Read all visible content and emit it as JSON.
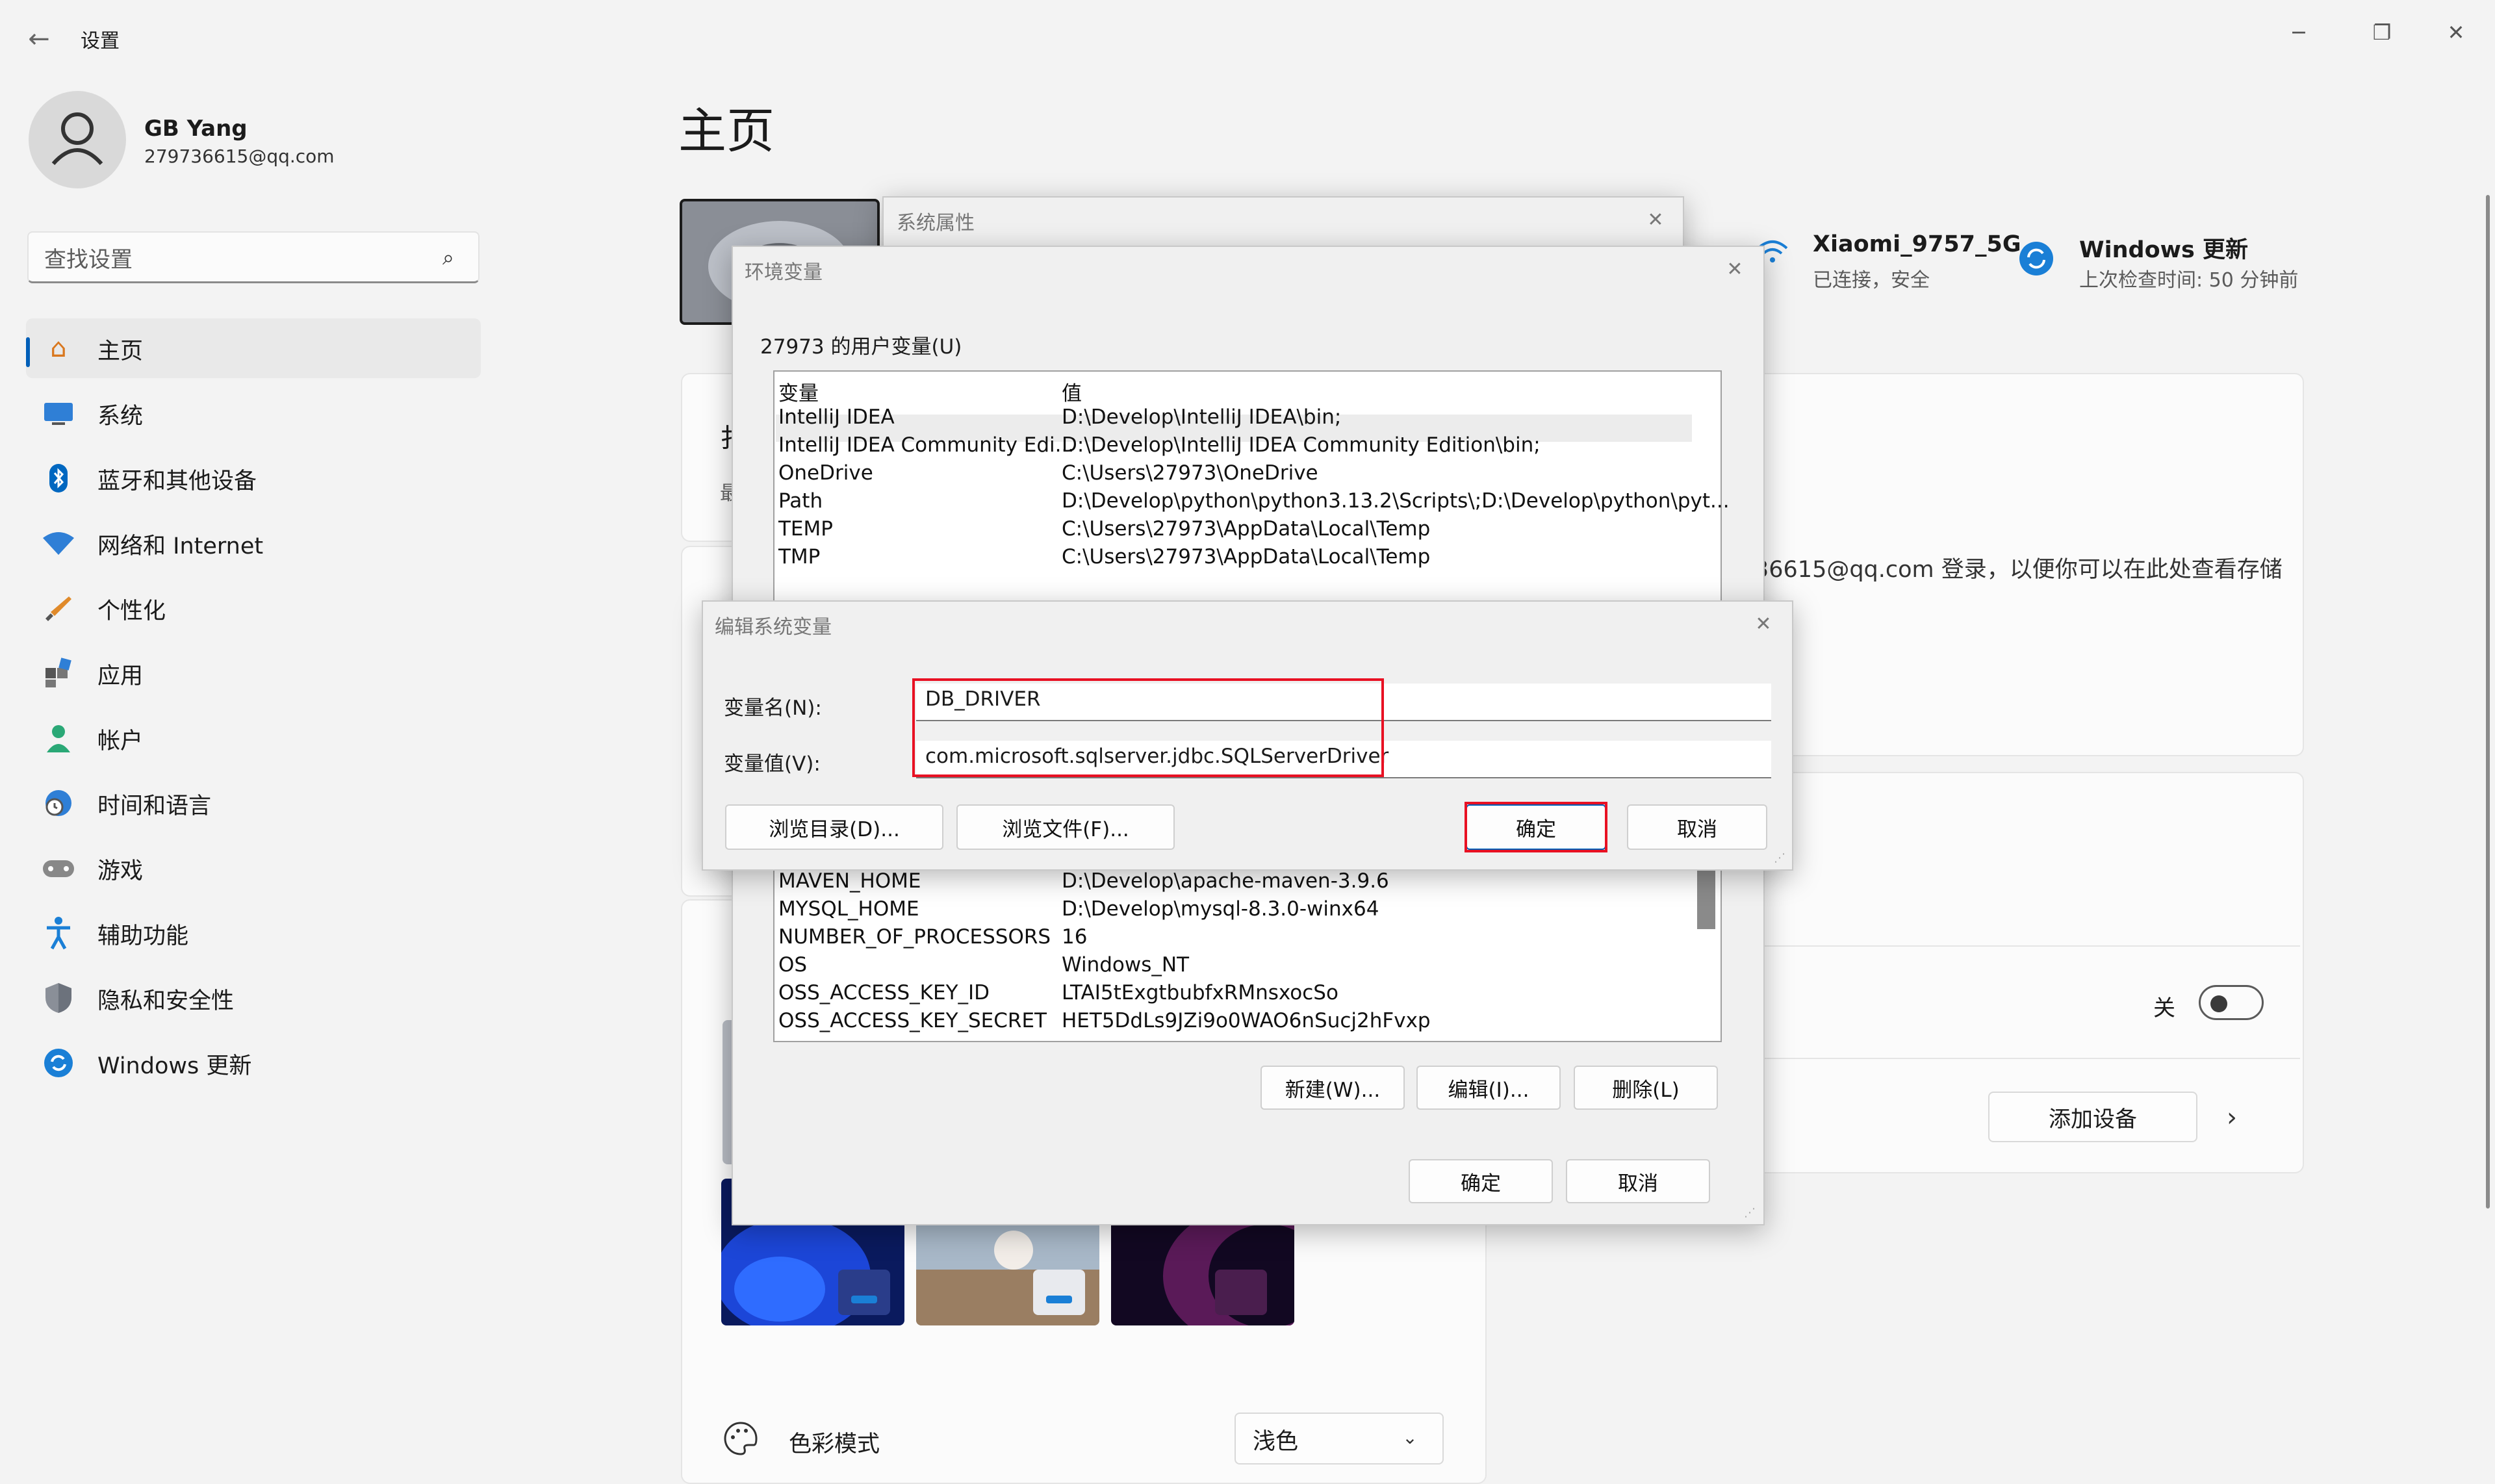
{
  "settings": {
    "title": "设置",
    "user": {
      "name": "GB Yang",
      "email": "279736615@qq.com"
    },
    "search_placeholder": "查找设置",
    "nav": [
      {
        "label": "主页",
        "icon": "home-icon"
      },
      {
        "label": "系统",
        "icon": "monitor-icon"
      },
      {
        "label": "蓝牙和其他设备",
        "icon": "bluetooth-icon"
      },
      {
        "label": "网络和 Internet",
        "icon": "wifi-icon"
      },
      {
        "label": "个性化",
        "icon": "brush-icon"
      },
      {
        "label": "应用",
        "icon": "apps-icon"
      },
      {
        "label": "帐户",
        "icon": "person-icon"
      },
      {
        "label": "时间和语言",
        "icon": "globe-clock-icon"
      },
      {
        "label": "游戏",
        "icon": "gamepad-icon"
      },
      {
        "label": "辅助功能",
        "icon": "accessibility-icon"
      },
      {
        "label": "隐私和安全性",
        "icon": "shield-icon"
      },
      {
        "label": "Windows 更新",
        "icon": "sync-icon"
      }
    ],
    "page_title": "主页",
    "wifi": {
      "name": "Xiaomi_9757_5G",
      "status": "已连接，安全"
    },
    "update": {
      "title": "Windows 更新",
      "status": "上次检查时间: 50 分钟前"
    },
    "onedrive_text": "36615@qq.com 登录，以便你可以在此处查看存储",
    "toggle_label": "关",
    "add_device": "添加设备",
    "color_mode": {
      "label": "色彩模式",
      "value": "浅色"
    },
    "partial_card_chars": [
      "扌",
      "最"
    ],
    "accent": "#005fb8"
  },
  "sys_props": {
    "title": "系统属性"
  },
  "env_vars": {
    "title": "环境变量",
    "user_section": "27973 的用户变量(U)",
    "headers": [
      "变量",
      "值"
    ],
    "user_vars": [
      {
        "name": "IntelliJ IDEA",
        "value": "D:\\Develop\\IntelliJ IDEA\\bin;"
      },
      {
        "name": "IntelliJ IDEA Community Edi...",
        "value": "D:\\Develop\\IntelliJ IDEA Community Edition\\bin;"
      },
      {
        "name": "OneDrive",
        "value": "C:\\Users\\27973\\OneDrive"
      },
      {
        "name": "Path",
        "value": "D:\\Develop\\python\\python3.13.2\\Scripts\\;D:\\Develop\\python\\pyt..."
      },
      {
        "name": "TEMP",
        "value": "C:\\Users\\27973\\AppData\\Local\\Temp"
      },
      {
        "name": "TMP",
        "value": "C:\\Users\\27973\\AppData\\Local\\Temp"
      }
    ],
    "system_vars": [
      {
        "name": "MAVEN_HOME",
        "value": "D:\\Develop\\apache-maven-3.9.6"
      },
      {
        "name": "MYSQL_HOME",
        "value": "D:\\Develop\\mysql-8.3.0-winx64"
      },
      {
        "name": "NUMBER_OF_PROCESSORS",
        "value": "16"
      },
      {
        "name": "OS",
        "value": "Windows_NT"
      },
      {
        "name": "OSS_ACCESS_KEY_ID",
        "value": "LTAI5tExgtbubfxRMnsxocSo"
      },
      {
        "name": "OSS_ACCESS_KEY_SECRET",
        "value": "HET5DdLs9JZi9o0WAO6nSucj2hFvxp"
      }
    ],
    "btn_new": "新建(W)...",
    "btn_edit": "编辑(I)...",
    "btn_delete": "删除(L)",
    "btn_ok": "确定",
    "btn_cancel": "取消"
  },
  "edit_dialog": {
    "title": "编辑系统变量",
    "name_label": "变量名(N):",
    "name_value": "DB_DRIVER",
    "value_label": "变量值(V):",
    "value_value": "com.microsoft.sqlserver.jdbc.SQLServerDriver",
    "btn_browse_dir": "浏览目录(D)...",
    "btn_browse_file": "浏览文件(F)...",
    "btn_ok": "确定",
    "btn_cancel": "取消",
    "highlight_color": "#e81123"
  }
}
